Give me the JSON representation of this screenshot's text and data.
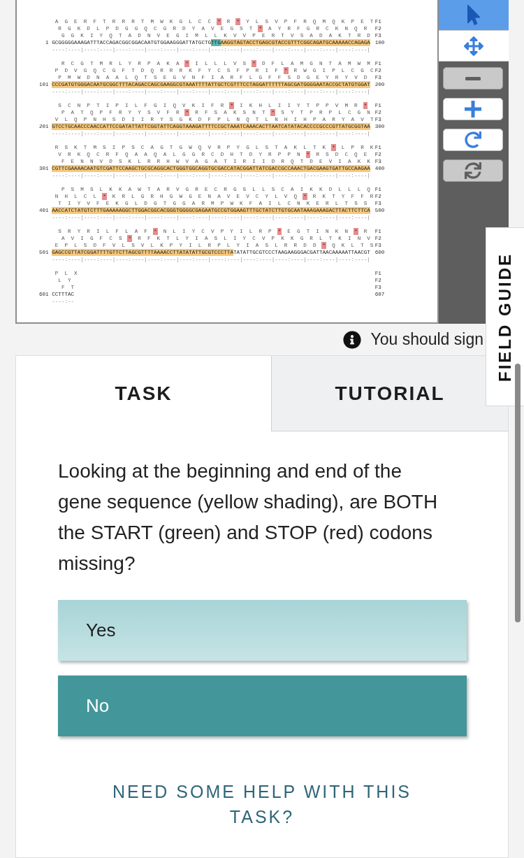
{
  "sequence_viewer": {
    "blocks": [
      {
        "start": "1",
        "end": "100",
        "frames": [
          {
            "label": "F1",
            "segments": [
              {
                "kind": "aa",
                "text": "A G E R F T R R R T M W K G L C C"
              },
              {
                "kind": "stop",
                "text": "*"
              },
              {
                "kind": "aa",
                "text": "R"
              },
              {
                "kind": "stop",
                "text": "*"
              },
              {
                "kind": "aa",
                "text": "Y L S V P F R Q M Q K P E T"
              }
            ]
          },
          {
            "label": "F2",
            "segments": [
              {
                "kind": "aa",
                "text": "R G K D L P D G G Q C G R D Y A V E G S T"
              },
              {
                "kind": "stop",
                "text": "*"
              },
              {
                "kind": "aa",
                "text": "A Y R F G R C K N Q R"
              }
            ]
          },
          {
            "label": "F3",
            "segments": [
              {
                "kind": "aa",
                "text": "G G K I Y Q T A D N V E G I M L L K V V P E R T V S A D A K T R D"
              }
            ]
          }
        ],
        "dna": [
          {
            "kind": "plain",
            "text": "GCGGGGGAAAGATTTACCAGACGGCGGACAATGTGGAAGGGATTATGCTG"
          },
          {
            "kind": "start",
            "text": "TTG"
          },
          {
            "kind": "gene",
            "text": "AAGGTAGTACCTGAGCGTACCGTTTCGGCAGATGCAAAAACCAGAGA"
          }
        ],
        "ruler": "----:----|----:----|----:----|----:----|----:----|----:----|----:----|----:----|----:----|----:----|"
      },
      {
        "start": "101",
        "end": "200",
        "frames": [
          {
            "label": "F1",
            "segments": [
              {
                "kind": "aa",
                "text": "R C G T M R L Y R P A K A"
              },
              {
                "kind": "stop",
                "text": "*"
              },
              {
                "kind": "aa",
                "text": "I L L L V S"
              },
              {
                "kind": "stop",
                "text": "*"
              },
              {
                "kind": "aa",
                "text": "D F L A M G N T A M W M"
              }
            ]
          },
          {
            "label": "F2",
            "segments": [
              {
                "kind": "aa",
                "text": "P D V G Q C G F T D Q R R R K F Y C S F P R I F"
              },
              {
                "kind": "stop",
                "text": "*"
              },
              {
                "kind": "aa",
                "text": "R W G I P L C G C"
              }
            ]
          },
          {
            "label": "F3",
            "segments": [
              {
                "kind": "aa",
                "text": "P M W D N A A L Q T S E G V N F I A R F L G F F S D G E Y R Y V D"
              }
            ]
          }
        ],
        "dna": [
          {
            "kind": "gene",
            "text": "CCCGATGTGGGACAATGCGGCTTTACAGACCAGCGAAGGCGTAAATTTTATTGCTCGTTTCCTAGGATTTTTTAGCGATGGGGAATACCGCTATGTGGAT"
          }
        ],
        "ruler": "----:----|----:----|----:----|----:----|----:----|----:----|----:----|----:----|----:----|----:----|"
      },
      {
        "start": "201",
        "end": "300",
        "frames": [
          {
            "label": "F1",
            "segments": [
              {
                "kind": "aa",
                "text": "S C N P T I P I L F G I Q V K I F R"
              },
              {
                "kind": "stop",
                "text": "*"
              },
              {
                "kind": "aa",
                "text": "I K H L I I Y T P P V M R"
              },
              {
                "kind": "stop",
                "text": "*"
              }
            ]
          },
          {
            "label": "F2",
            "segments": [
              {
                "kind": "aa",
                "text": "P A T Q P F R Y Y S V F R"
              },
              {
                "kind": "stop",
                "text": "*"
              },
              {
                "kind": "aa",
                "text": "R F S A K S N T"
              },
              {
                "kind": "stop",
                "text": "*"
              },
              {
                "kind": "aa",
                "text": "S Y T P R P L C G N"
              }
            ]
          },
          {
            "label": "F3",
            "segments": [
              {
                "kind": "aa",
                "text": "V L Q P N H S D I I R Y S G K D F P L N Q T L N H I H P A R Y A V T"
              }
            ]
          }
        ],
        "dna": [
          {
            "kind": "gene",
            "text": "GTCCTGCAACCCAACCATTCCGATATTATTCGGTATTCAGGTAAAGATTTTCCGCTAAATCAAACACTTAATCATATACACCCCGCCCGTTATGCGGTAA"
          }
        ],
        "ruler": "----:----|----:----|----:----|----:----|----:----|----:----|----:----|----:----|----:----|----:----|"
      },
      {
        "start": "301",
        "end": "400",
        "frames": [
          {
            "label": "F1",
            "segments": [
              {
                "kind": "aa",
                "text": "R S K T M S I P S C A G T G W Q V R P Y G L S T A K L T K"
              },
              {
                "kind": "stop",
                "text": "*"
              },
              {
                "kind": "aa",
                "text": "L P R K"
              }
            ]
          },
          {
            "label": "F2",
            "segments": [
              {
                "kind": "aa",
                "text": "V R K Q C R F Q A A Q A L G G R C D H T D Y R P P N"
              },
              {
                "kind": "stop",
                "text": "*"
              },
              {
                "kind": "aa",
                "text": "R S D C Q E"
              }
            ]
          },
          {
            "label": "F3",
            "segments": [
              {
                "kind": "aa",
                "text": "F E N N V D S K L R R H W V A G A T I R I I D R Q T D E V I A K K"
              }
            ]
          }
        ],
        "dna": [
          {
            "kind": "gene",
            "text": "CGTTCGAAAACAATGTCGATTCCAAGCTGCGCAGGCACTGGGTGGCAGGTGCGACCATACGGATTATCGACCGCCAAACTGACGAAGTGATTGCCAAGAA"
          }
        ],
        "ruler": "----:----|----:----|----:----|----:----|----:----|----:----|----:----|----:----|----:----|----:----|"
      },
      {
        "start": "401",
        "end": "500",
        "frames": [
          {
            "label": "F1",
            "segments": [
              {
                "kind": "aa",
                "text": "P S M S L K K A W T A R V G R E C R G S L L S C A I K K D L L L Q"
              }
            ]
          },
          {
            "label": "F2",
            "segments": [
              {
                "kind": "aa",
                "text": "N H L C L"
              },
              {
                "kind": "stop",
                "text": "*"
              },
              {
                "kind": "aa",
                "text": "K R L G R H G W G E N A V E V C Y L V Q"
              },
              {
                "kind": "stop",
                "text": "*"
              },
              {
                "kind": "aa",
                "text": "R K T Y F F R"
              }
            ]
          },
          {
            "label": "F3",
            "segments": [
              {
                "kind": "aa",
                "text": "T I Y V F E K G L D G T G G A R M P W K F A I L C N K E R L T S S"
              }
            ]
          }
        ],
        "dna": [
          {
            "kind": "gene",
            "text": "AACCATCTATGTCTTTGAAAAAGGCTTGGACGGCACGGGTGGGGCGAGAATGCCGTGGAAGTTTGCTATCTTGTGCAATAAAGAAAGACTTACTTCTTCA"
          }
        ],
        "ruler": "----:----|----:----|----:----|----:----|----:----|----:----|----:----|----:----|----:----|----:----|"
      },
      {
        "start": "501",
        "end": "600",
        "frames": [
          {
            "label": "F1",
            "segments": [
              {
                "kind": "aa",
                "text": "S R Y R I L F L A F"
              },
              {
                "kind": "stop",
                "text": "*"
              },
              {
                "kind": "aa",
                "text": "N L I Y C V P Y I L R P"
              },
              {
                "kind": "stop",
                "text": "*"
              },
              {
                "kind": "aa",
                "text": "E G T I N K N"
              },
              {
                "kind": "stop",
                "text": "*"
              },
              {
                "kind": "aa",
                "text": "R"
              }
            ]
          },
          {
            "label": "F2",
            "segments": [
              {
                "kind": "aa",
                "text": "A V I G F C S"
              },
              {
                "kind": "stop",
                "text": "*"
              },
              {
                "kind": "aa",
                "text": "R F K T L Y I A S L I Y C V P K K G R L T K I N V"
              }
            ]
          },
          {
            "label": "F3",
            "segments": [
              {
                "kind": "aa",
                "text": "E P L S D F V L S V L K P Y I L R P L Y I A S L R R D D"
              },
              {
                "kind": "stop",
                "text": "*"
              },
              {
                "kind": "aa",
                "text": "Q K L T S"
              }
            ]
          }
        ],
        "dna": [
          {
            "kind": "gene",
            "text": "GAGCCGTTATCGGATTTTGTTCTTAGCGTTTTAAAACCTTATATATTGCGTCCCTTA"
          },
          {
            "kind": "plain",
            "text": "TATATTGCGTCCCTAAGAAGGGACGATTAACAAAAATTAACGT"
          }
        ],
        "ruler": "----:----|----:----|----:----|----:----|----:----|----:----|----:----|----:----|----:----|----:----|"
      },
      {
        "start": "601",
        "end": "607",
        "frames": [
          {
            "label": "F1",
            "segments": [
              {
                "kind": "aa",
                "text": "P L X"
              }
            ]
          },
          {
            "label": "F2",
            "segments": [
              {
                "kind": "aa",
                "text": "L Y"
              }
            ]
          },
          {
            "label": "F3",
            "segments": [
              {
                "kind": "aa",
                "text": "F T"
              }
            ]
          }
        ],
        "dna": [
          {
            "kind": "plain",
            "text": "CCTTTAC"
          }
        ],
        "ruler": "----:--"
      }
    ]
  },
  "toolbar": {
    "tools": [
      {
        "kind": "pointer",
        "selected": true
      },
      {
        "kind": "move",
        "selected": false
      }
    ],
    "controls": [
      {
        "kind": "zoom-out",
        "disabled": true
      },
      {
        "kind": "zoom-in",
        "disabled": false
      },
      {
        "kind": "rotate",
        "disabled": false
      },
      {
        "kind": "reset",
        "disabled": true
      }
    ]
  },
  "notice": {
    "text": "You should sign"
  },
  "field_guide_tab": {
    "label": "FIELD GUIDE"
  },
  "tabs": [
    {
      "label": "TASK",
      "selected": true
    },
    {
      "label": "TUTORIAL",
      "selected": false
    }
  ],
  "task": {
    "question": "Looking at the beginning and end of the gene sequence (yellow shading), are BOTH the START (green) and STOP (red) codons missing?",
    "answers": [
      {
        "label": "Yes",
        "selected": false
      },
      {
        "label": "No",
        "selected": true
      }
    ],
    "help_link": {
      "label": "NEED SOME HELP WITH THIS TASK?"
    }
  }
}
